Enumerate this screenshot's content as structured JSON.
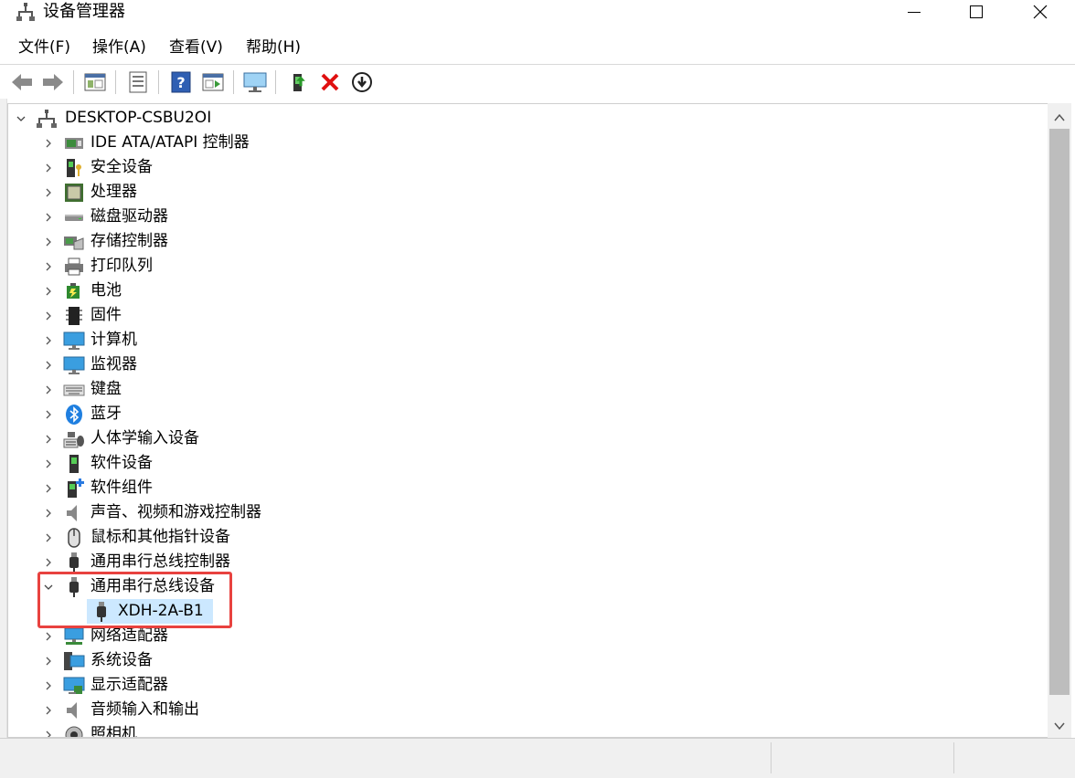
{
  "window": {
    "title": "设备管理器",
    "controls": {
      "minimize": "minimize",
      "maximize": "maximize",
      "close": "close"
    }
  },
  "menubar": [
    {
      "label": "文件(F)"
    },
    {
      "label": "操作(A)"
    },
    {
      "label": "查看(V)"
    },
    {
      "label": "帮助(H)"
    }
  ],
  "toolbar": [
    {
      "icon": "back-arrow-icon"
    },
    {
      "icon": "forward-arrow-icon"
    },
    {
      "icon": "show-hide-console-tree-icon"
    },
    {
      "icon": "properties-icon"
    },
    {
      "icon": "help-icon"
    },
    {
      "icon": "action-pane-icon"
    },
    {
      "icon": "scan-hardware-monitor-icon"
    },
    {
      "icon": "update-driver-icon"
    },
    {
      "icon": "uninstall-device-icon"
    },
    {
      "icon": "disable-device-icon"
    }
  ],
  "tree": {
    "root": {
      "label": "DESKTOP-CSBU2OI",
      "expanded": true
    },
    "categories": [
      {
        "label": "IDE ATA/ATAPI 控制器",
        "icon": "ide-controller-icon"
      },
      {
        "label": "安全设备",
        "icon": "security-device-icon"
      },
      {
        "label": "处理器",
        "icon": "processor-icon"
      },
      {
        "label": "磁盘驱动器",
        "icon": "disk-drive-icon"
      },
      {
        "label": "存储控制器",
        "icon": "storage-controller-icon"
      },
      {
        "label": "打印队列",
        "icon": "printer-icon"
      },
      {
        "label": "电池",
        "icon": "battery-icon"
      },
      {
        "label": "固件",
        "icon": "firmware-icon"
      },
      {
        "label": "计算机",
        "icon": "computer-icon"
      },
      {
        "label": "监视器",
        "icon": "monitor-icon"
      },
      {
        "label": "键盘",
        "icon": "keyboard-icon"
      },
      {
        "label": "蓝牙",
        "icon": "bluetooth-icon"
      },
      {
        "label": "人体学输入设备",
        "icon": "hid-icon"
      },
      {
        "label": "软件设备",
        "icon": "software-device-icon"
      },
      {
        "label": "软件组件",
        "icon": "software-component-icon"
      },
      {
        "label": "声音、视频和游戏控制器",
        "icon": "sound-icon"
      },
      {
        "label": "鼠标和其他指针设备",
        "icon": "mouse-icon"
      },
      {
        "label": "通用串行总线控制器",
        "icon": "usb-icon"
      },
      {
        "label": "通用串行总线设备",
        "icon": "usb-icon",
        "expanded": true,
        "children": [
          {
            "label": "XDH-2A-B1",
            "icon": "usb-icon",
            "selected": true
          }
        ]
      },
      {
        "label": "网络适配器",
        "icon": "network-adapter-icon"
      },
      {
        "label": "系统设备",
        "icon": "system-device-icon"
      },
      {
        "label": "显示适配器",
        "icon": "display-adapter-icon"
      },
      {
        "label": "音频输入和输出",
        "icon": "audio-io-icon"
      },
      {
        "label": "照相机",
        "icon": "camera-icon"
      }
    ]
  },
  "colors": {
    "selection": "#cce8ff",
    "highlight_border": "#e8423f",
    "scroll_thumb": "#bdbdbd"
  }
}
